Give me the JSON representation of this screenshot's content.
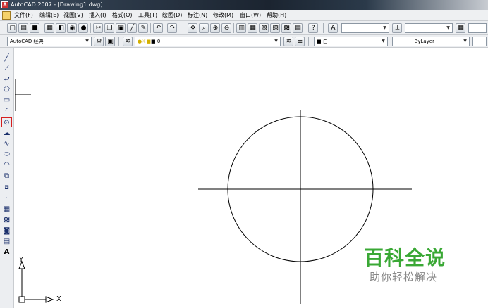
{
  "window": {
    "title": "AutoCAD 2007 - [Drawing1.dwg]",
    "app_icon_label": "A"
  },
  "menu": {
    "items": [
      "文件(F)",
      "编辑(E)",
      "视图(V)",
      "插入(I)",
      "格式(O)",
      "工具(T)",
      "绘图(D)",
      "标注(N)",
      "修改(M)",
      "窗口(W)",
      "帮助(H)"
    ]
  },
  "toolbar2": {
    "workspace": "AutoCAD 经典",
    "layer_name": "0",
    "color": "白",
    "linetype": "ByLayer"
  },
  "canvas": {
    "ucs_y_label": "Y",
    "ucs_x_label": "X"
  },
  "watermark": {
    "title": "百科全说",
    "subtitle": "助你轻松解决"
  },
  "colors": {
    "watermark_green": "#3aa835",
    "selected_tool_border": "#d61f1f"
  },
  "icons": {
    "left_tools": [
      "line-icon",
      "construction-line-icon",
      "polyline-icon",
      "polygon-icon",
      "rectangle-icon",
      "arc-icon",
      "circle-icon",
      "revision-cloud-icon",
      "spline-icon",
      "ellipse-icon",
      "ellipse-arc-icon",
      "insert-block-icon",
      "make-block-icon",
      "point-icon",
      "hatch-icon",
      "gradient-icon",
      "region-icon",
      "table-icon",
      "multiline-text-icon"
    ]
  }
}
